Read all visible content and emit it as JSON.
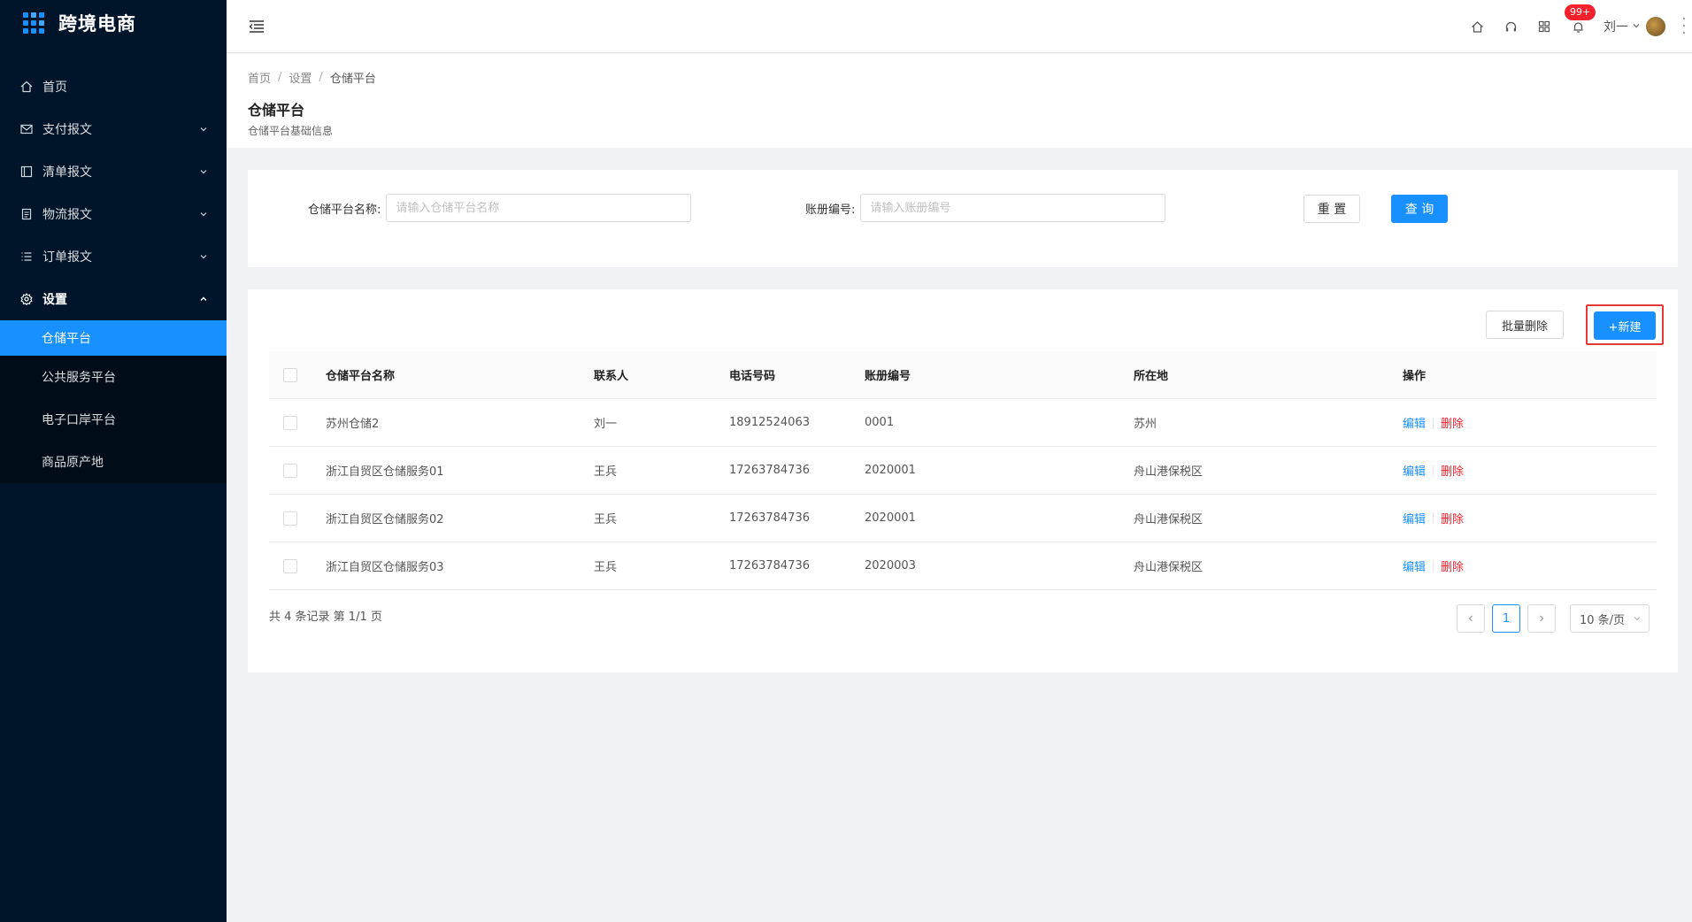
{
  "app": {
    "title": "跨境电商"
  },
  "sidebar": {
    "items": [
      {
        "label": "首页",
        "icon": "home-icon"
      },
      {
        "label": "支付报文",
        "icon": "mail-icon"
      },
      {
        "label": "清单报文",
        "icon": "list-box-icon"
      },
      {
        "label": "物流报文",
        "icon": "doc-icon"
      },
      {
        "label": "订单报文",
        "icon": "bullet-list-icon"
      },
      {
        "label": "设置",
        "icon": "gear-icon"
      }
    ],
    "submenu": [
      {
        "label": "仓储平台",
        "active": true
      },
      {
        "label": "公共服务平台"
      },
      {
        "label": "电子口岸平台"
      },
      {
        "label": "商品原产地"
      }
    ]
  },
  "header": {
    "badge": "99+",
    "user_name": "刘一"
  },
  "page": {
    "breadcrumb": [
      "首页",
      "设置",
      "仓储平台"
    ],
    "title": "仓储平台",
    "subtitle": "仓储平台基础信息"
  },
  "search": {
    "name_label": "仓储平台名称:",
    "name_placeholder": "请输入仓储平台名称",
    "acct_label": "账册编号:",
    "acct_placeholder": "请输入账册编号",
    "reset_label": "重 置",
    "query_label": "查 询"
  },
  "toolbar": {
    "batch_delete_label": "批量删除",
    "new_label": "+新建"
  },
  "table": {
    "columns": [
      "仓储平台名称",
      "联系人",
      "电话号码",
      "账册编号",
      "所在地",
      "操作"
    ],
    "rows": [
      {
        "name": "苏州仓储2",
        "contact": "刘一",
        "phone": "18912524063",
        "account": "0001",
        "location": "苏州"
      },
      {
        "name": "浙江自贸区仓储服务01",
        "contact": "王兵",
        "phone": "17263784736",
        "account": "2020001",
        "location": "舟山港保税区"
      },
      {
        "name": "浙江自贸区仓储服务02",
        "contact": "王兵",
        "phone": "17263784736",
        "account": "2020001",
        "location": "舟山港保税区"
      },
      {
        "name": "浙江自贸区仓储服务03",
        "contact": "王兵",
        "phone": "17263784736",
        "account": "2020003",
        "location": "舟山港保税区"
      }
    ],
    "edit_label": "编辑",
    "delete_label": "删除"
  },
  "pagination": {
    "summary": "共 4 条记录 第 1/1 页",
    "current_page": "1",
    "page_size": "10 条/页"
  },
  "colors": {
    "primary": "#1890ff",
    "danger": "#f5222d",
    "sidebar_bg": "#001529"
  }
}
